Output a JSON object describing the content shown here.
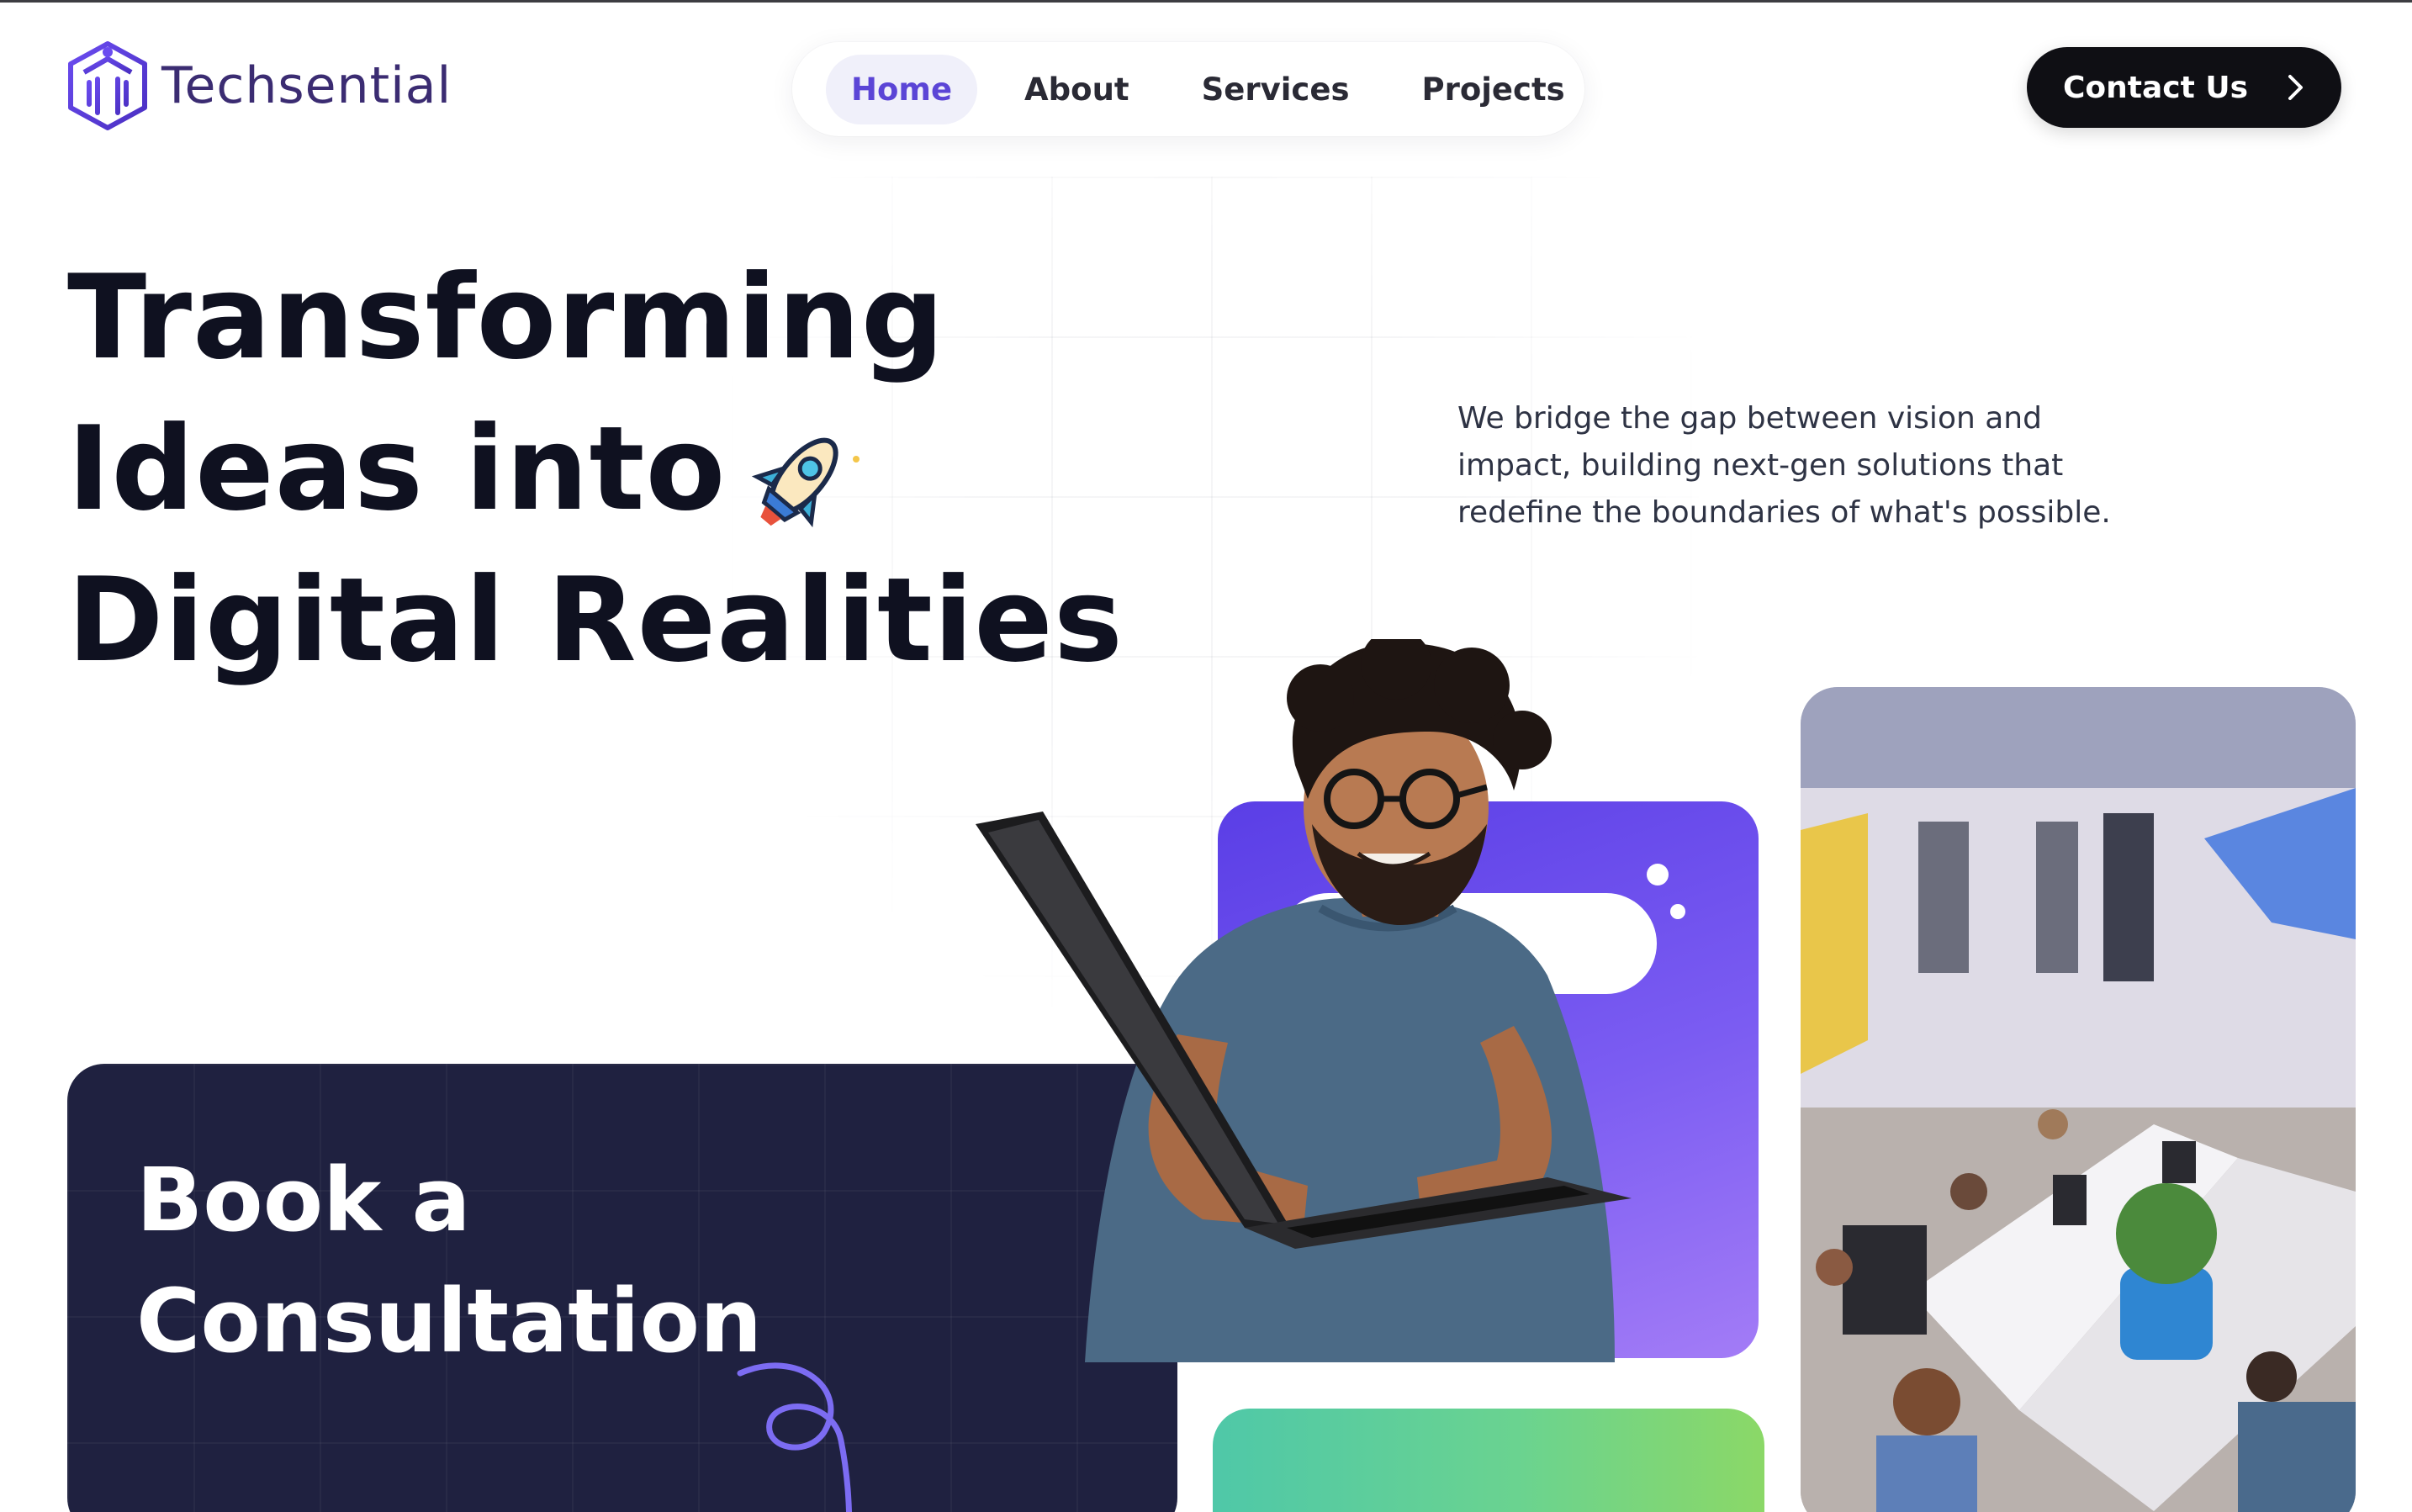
{
  "brand": {
    "name": "Techsential",
    "logo_color": "#5b45d6"
  },
  "nav": {
    "items": [
      {
        "label": "Home",
        "active": true
      },
      {
        "label": "About",
        "active": false
      },
      {
        "label": "Services",
        "active": false
      },
      {
        "label": "Projects",
        "active": false
      }
    ]
  },
  "header": {
    "contact_label": "Contact Us",
    "contact_icon": "chevron-right-icon"
  },
  "hero": {
    "title_line1": "Transforming",
    "title_line2": "Ideas into",
    "title_line3": "Digital Realities",
    "title_icon": "rocket-icon",
    "description": "We bridge the gap between vision and impact, building next-gen solutions that redefine the boundaries of what's possible."
  },
  "cards": {
    "consultation_title": "Book a\nConsultation",
    "consultation_bg": "#1f2140",
    "purple_card_bg": "#6a4ef0",
    "green_card_bg": "#6ad390"
  },
  "images": {
    "person": "person-with-laptop-photo",
    "office": "office-team-photo"
  },
  "colors": {
    "accent": "#5b45d6",
    "text": "#0f1120",
    "button": "#0f0f14"
  }
}
